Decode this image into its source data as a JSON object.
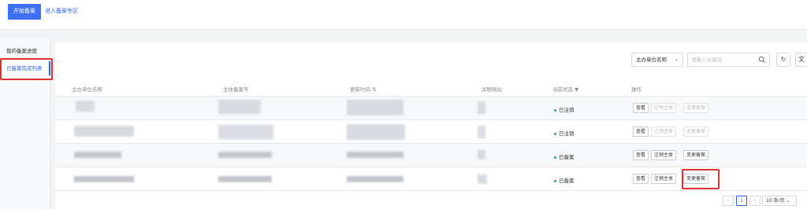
{
  "header": {
    "start_button": "开始备案",
    "enter_link": "进入备案专区"
  },
  "sidebar": {
    "items": [
      {
        "label": "我的备案进度"
      },
      {
        "label": "已备案完成列表"
      }
    ]
  },
  "toolbar": {
    "filter_select": "主办单位名称",
    "search_placeholder": "请输入关键词",
    "refresh_icon": "refresh-icon",
    "export_label": "文"
  },
  "table": {
    "columns": [
      "主办单位名称",
      "主体备案号",
      "更新时间",
      "关联网站",
      "当前状态",
      "操作"
    ],
    "rows": [
      {
        "status": "已注销",
        "actions": [
          "查看",
          "注销主体",
          "变更备案"
        ],
        "enabled": [
          true,
          false,
          false
        ]
      },
      {
        "status": "已注销",
        "actions": [
          "查看",
          "注销主体",
          "变更备案"
        ],
        "enabled": [
          true,
          false,
          false
        ]
      },
      {
        "status": "已备案",
        "actions": [
          "查看",
          "注销主体",
          "变更备案"
        ],
        "enabled": [
          true,
          true,
          true
        ]
      },
      {
        "status": "已备案",
        "actions": [
          "查看",
          "注销主体",
          "变更备案"
        ],
        "enabled": [
          true,
          true,
          true
        ]
      }
    ]
  },
  "pagination": {
    "prev": "‹",
    "current": "1",
    "next": "›",
    "page_size": "10 条/页"
  },
  "colors": {
    "primary": "#3e6ff5",
    "highlight": "#e03131",
    "status_dot": "#2ba471"
  }
}
